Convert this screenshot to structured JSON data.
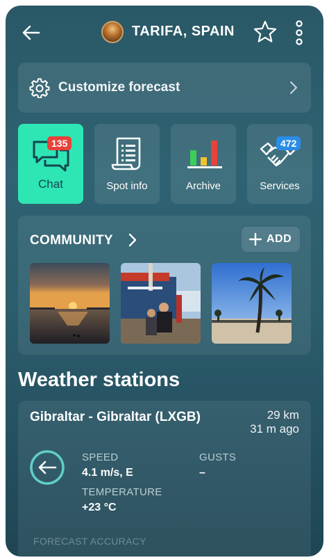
{
  "header": {
    "location": "TARIFA, SPAIN"
  },
  "customize": {
    "label": "Customize forecast"
  },
  "tiles": [
    {
      "label": "Chat",
      "badge": "135"
    },
    {
      "label": "Spot info"
    },
    {
      "label": "Archive"
    },
    {
      "label": "Services",
      "badge": "472"
    }
  ],
  "community": {
    "title": "COMMUNITY",
    "add_label": "ADD"
  },
  "weather": {
    "section_title": "Weather stations",
    "station": {
      "name": "Gibraltar - Gibraltar (LXGB)",
      "distance": "29 km",
      "updated": "31 m ago",
      "speed_label": "SPEED",
      "speed_value": "4.1 m/s, E",
      "gusts_label": "GUSTS",
      "gusts_value": "–",
      "temp_label": "TEMPERATURE",
      "temp_value": "+23 °C"
    },
    "forecast_accuracy": "FORECAST ACCURACY"
  },
  "colors": {
    "accent": "#2ee6b4",
    "badge_red": "#e8423a",
    "badge_blue": "#2a8de6",
    "background": "#2c5d6d"
  },
  "icons": [
    "back-arrow-icon",
    "star-icon",
    "more-vertical-icon",
    "gear-icon",
    "chevron-right-icon",
    "chat-icon",
    "document-icon",
    "bar-chart-icon",
    "handshake-icon",
    "plus-icon",
    "wind-direction-icon"
  ]
}
